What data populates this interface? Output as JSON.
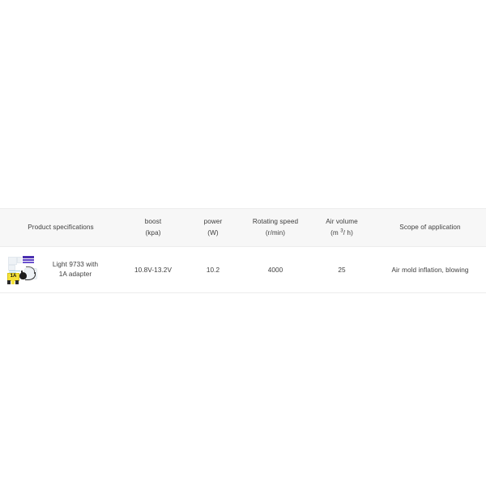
{
  "page": {
    "background_color": "#ffffff"
  },
  "table": {
    "name": "product-specification-table",
    "header_background": "#f7f7f7",
    "border_color": "#ededed",
    "text_color": "#3d3d3d",
    "columns": [
      {
        "key": "spec",
        "line1": "Product specifications",
        "line2": ""
      },
      {
        "key": "boost",
        "line1": "boost",
        "line2": "(kpa)"
      },
      {
        "key": "power",
        "line1": "power",
        "line2": "(W)"
      },
      {
        "key": "speed",
        "line1": "Rotating speed",
        "line2": "(r/min)"
      },
      {
        "key": "air",
        "line1": "Air volume",
        "line2_prefix": "(m ",
        "line2_sup": "3",
        "line2_suffix": "/ h)"
      },
      {
        "key": "scope",
        "line1": "Scope of application",
        "line2": ""
      }
    ],
    "rows": [
      {
        "product": {
          "image_alt": "product-photo-light-9733-adapter",
          "name_line1": "Light 9733 with",
          "name_line2": "1A adapter",
          "image_labels": {
            "amperage_sticker": "1A"
          }
        },
        "boost": "10.8V-13.2V",
        "power": "10.2",
        "speed": "4000",
        "air_volume": "25",
        "scope": "Air mold inflation, blowing"
      }
    ]
  }
}
